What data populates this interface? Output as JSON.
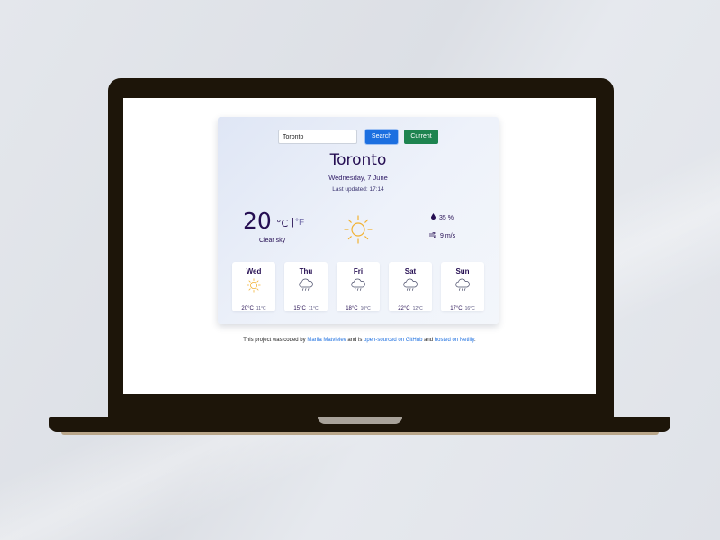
{
  "search": {
    "value": "Toronto",
    "search_label": "Search",
    "current_label": "Current"
  },
  "weather": {
    "city": "Toronto",
    "date": "Wednesday, 7 June",
    "updated": "Last updated: 17:14",
    "temperature": "20",
    "unit_c": "°C",
    "unit_sep": "|",
    "unit_f": "°F",
    "description": "Clear sky",
    "humidity": "35 %",
    "wind": "9 m/s",
    "icon": "sun-icon"
  },
  "forecast": [
    {
      "day": "Wed",
      "max": "20°C",
      "min": "11°C",
      "icon": "sun-icon"
    },
    {
      "day": "Thu",
      "max": "15°C",
      "min": "11°C",
      "icon": "cloud-rain-icon"
    },
    {
      "day": "Fri",
      "max": "18°C",
      "min": "10°C",
      "icon": "cloud-rain-icon"
    },
    {
      "day": "Sat",
      "max": "22°C",
      "min": "12°C",
      "icon": "cloud-rain-icon"
    },
    {
      "day": "Sun",
      "max": "17°C",
      "min": "16°C",
      "icon": "cloud-rain-icon"
    }
  ],
  "footer": {
    "t1": "This project was coded by ",
    "author": "Mariia Matvieiev",
    "t2": " and is ",
    "source": "open-sourced on GitHub",
    "t3": " and ",
    "host": "hosted on Netlify",
    "t4": "."
  },
  "colors": {
    "primary_text": "#250e52",
    "search_button": "#1c6fe0",
    "current_button": "#1e8450",
    "sun": "#f2b233",
    "link": "#1c6fe0"
  }
}
